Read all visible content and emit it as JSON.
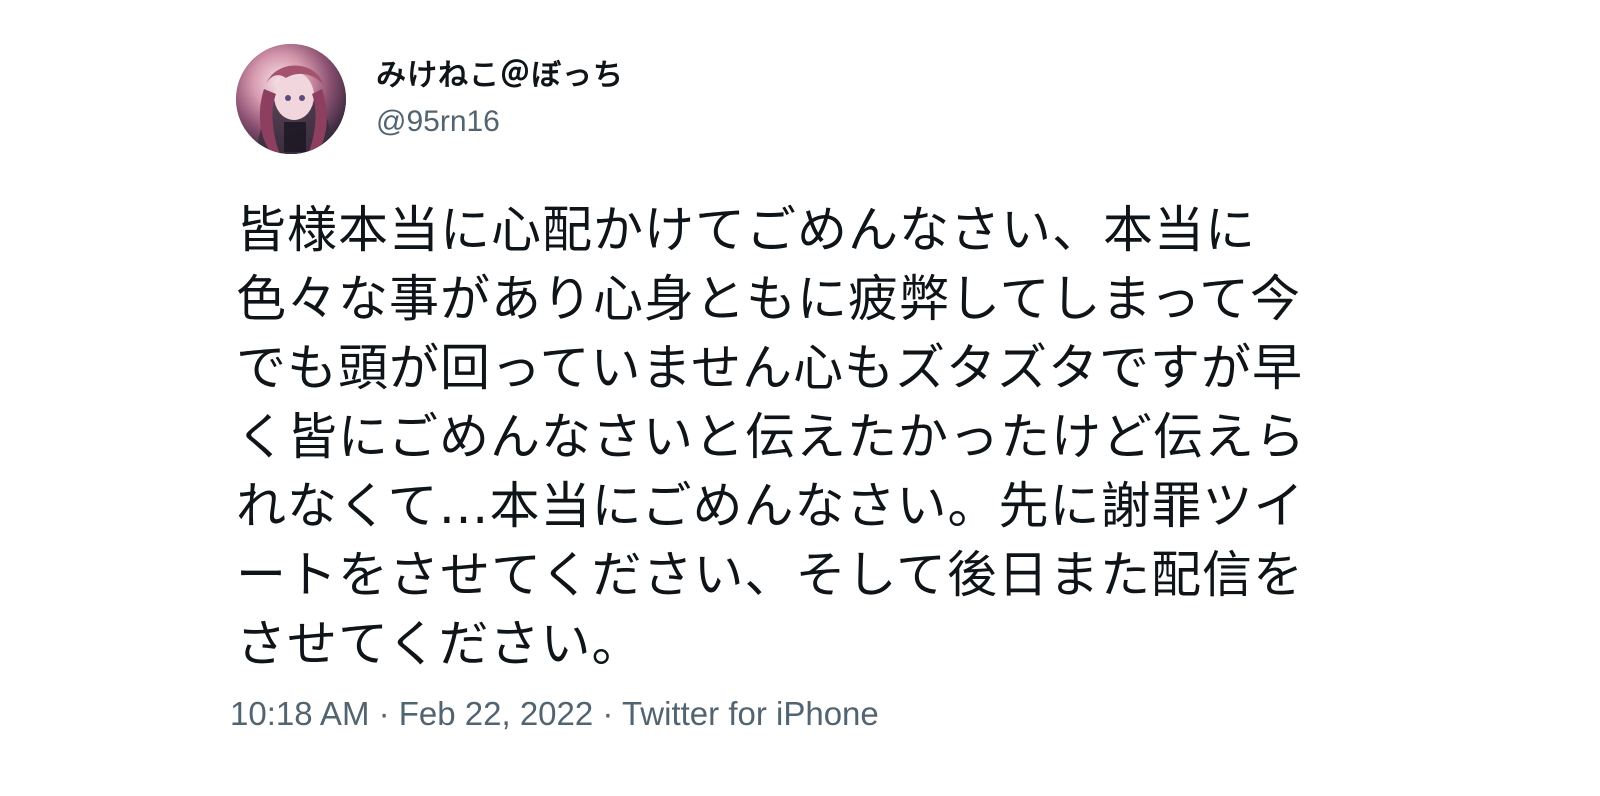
{
  "tweet": {
    "display_name": "みけねこ＠ぼっち",
    "handle": "@95rn16",
    "text": "皆様本当に心配かけてごめんなさい、本当に色々な事があり心身ともに疲弊してしまって今でも頭が回っていません心もズタズタですが早く皆にごめんなさいと伝えたかったけど伝えられなくて…本当にごめんなさい。先に謝罪ツイートをさせてください、そして後日また配信をさせてください。",
    "timestamp": "10:18 AM · Feb 22, 2022 · Twitter for iPhone"
  },
  "icons": {
    "avatar": "user-avatar-image"
  },
  "colors": {
    "text": "#0f1419",
    "secondary": "#536471",
    "background": "#ffffff"
  }
}
